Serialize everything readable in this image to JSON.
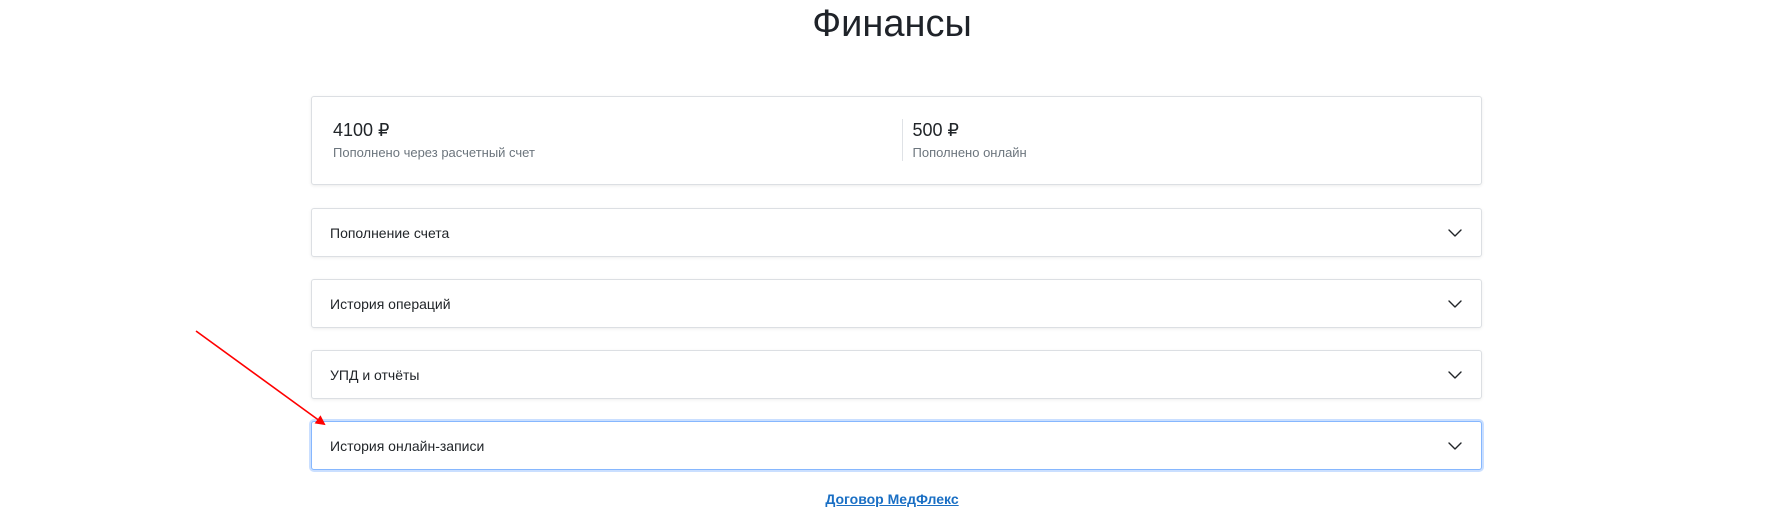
{
  "page": {
    "title": "Финансы"
  },
  "summary": [
    {
      "amount": "4100 ₽",
      "caption": "Пополнено через расчетный счет"
    },
    {
      "amount": "500 ₽",
      "caption": "Пополнено онлайн"
    }
  ],
  "accordion": [
    {
      "label": "Пополнение счета",
      "icon": "chevron-down-icon"
    },
    {
      "label": "История операций",
      "icon": "chevron-down-icon"
    },
    {
      "label": "УПД и отчёты",
      "icon": "chevron-down-icon"
    },
    {
      "label": "История онлайн-записи",
      "icon": "chevron-down-icon"
    }
  ],
  "footer": {
    "link_label": "Договор МедФлекс"
  },
  "colors": {
    "focus_border": "#86b7fe",
    "link": "#1a6fc4",
    "annotation_arrow": "#ff0000"
  }
}
